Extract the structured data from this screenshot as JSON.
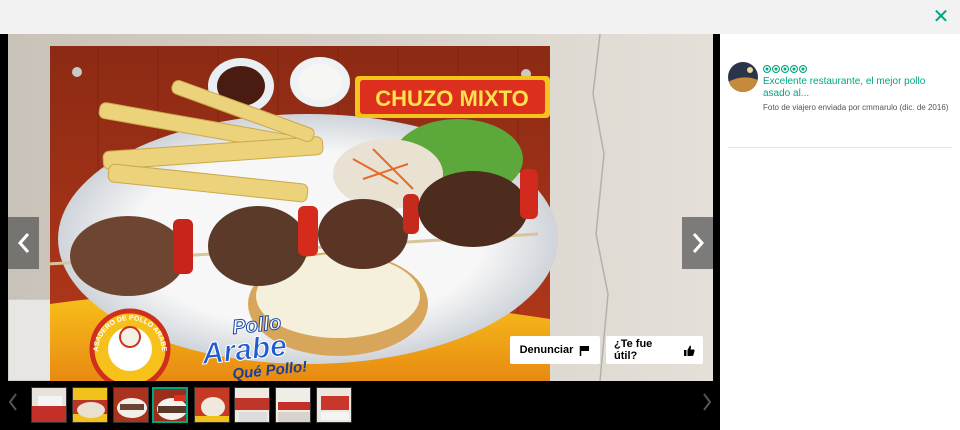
{
  "header": {
    "close_icon": "close-icon",
    "close_glyph": "✕",
    "accent_color": "#00a680"
  },
  "photo": {
    "description_icon": "food-photo",
    "sign_heading": "CHUZO MIXTO",
    "logo_lines": [
      "ASADERO DE POLLO ARABE"
    ],
    "brand_line1": "Pollo",
    "brand_line2": "Arabe",
    "brand_slogan": "Qué Pollo!"
  },
  "actions": {
    "report_label": "Denunciar",
    "report_icon": "flag-icon",
    "helpful_label": "¿Te fue útil?",
    "helpful_icon": "thumbs-up-icon"
  },
  "navigation": {
    "prev_icon": "chevron-left-icon",
    "next_icon": "chevron-right-icon"
  },
  "thumbnails": {
    "count": 8,
    "active_index": 3
  },
  "review": {
    "rating": 5,
    "rating_max": 5,
    "title": "Excelente restaurante, el mejor pollo asado al...",
    "meta": "Foto de viajero enviada por cmmarulo (dic. de 2016)"
  }
}
